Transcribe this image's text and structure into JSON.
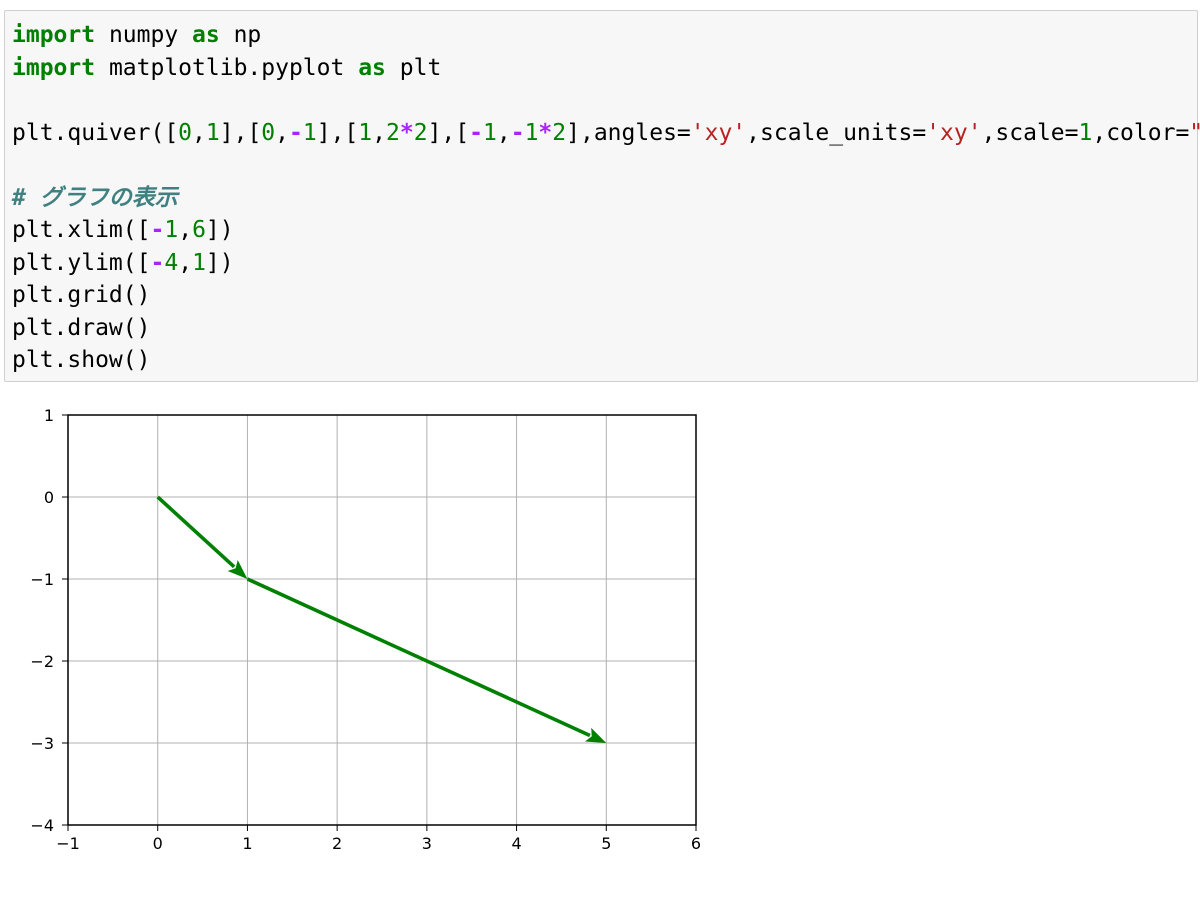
{
  "code_cell": {
    "lines": [
      [
        {
          "t": "import",
          "c": "kw"
        },
        {
          "t": " numpy "
        },
        {
          "t": "as",
          "c": "kw"
        },
        {
          "t": " np"
        }
      ],
      [
        {
          "t": "import",
          "c": "kw"
        },
        {
          "t": " matplotlib.pyplot "
        },
        {
          "t": "as",
          "c": "kw"
        },
        {
          "t": " plt"
        }
      ],
      [],
      [
        {
          "t": "plt.quiver(["
        },
        {
          "t": "0",
          "c": "num"
        },
        {
          "t": ","
        },
        {
          "t": "1",
          "c": "num"
        },
        {
          "t": "],["
        },
        {
          "t": "0",
          "c": "num"
        },
        {
          "t": ","
        },
        {
          "t": "-",
          "c": "op"
        },
        {
          "t": "1",
          "c": "num"
        },
        {
          "t": "],["
        },
        {
          "t": "1",
          "c": "num"
        },
        {
          "t": ","
        },
        {
          "t": "2",
          "c": "num"
        },
        {
          "t": "*",
          "c": "op"
        },
        {
          "t": "2",
          "c": "num"
        },
        {
          "t": "],["
        },
        {
          "t": "-",
          "c": "op"
        },
        {
          "t": "1",
          "c": "num"
        },
        {
          "t": ","
        },
        {
          "t": "-",
          "c": "op"
        },
        {
          "t": "1",
          "c": "num"
        },
        {
          "t": "*",
          "c": "op"
        },
        {
          "t": "2",
          "c": "num"
        },
        {
          "t": "],angles="
        },
        {
          "t": "'xy'",
          "c": "str"
        },
        {
          "t": ",scale_units="
        },
        {
          "t": "'xy'",
          "c": "str"
        },
        {
          "t": ",scale="
        },
        {
          "t": "1",
          "c": "num"
        },
        {
          "t": ",color="
        },
        {
          "t": "\"g\"",
          "c": "str"
        },
        {
          "t": ")"
        }
      ],
      [],
      [
        {
          "t": "# グラフの表示",
          "c": "cm"
        }
      ],
      [
        {
          "t": "plt.xlim(["
        },
        {
          "t": "-",
          "c": "op"
        },
        {
          "t": "1",
          "c": "num"
        },
        {
          "t": ","
        },
        {
          "t": "6",
          "c": "num"
        },
        {
          "t": "])"
        }
      ],
      [
        {
          "t": "plt.ylim(["
        },
        {
          "t": "-",
          "c": "op"
        },
        {
          "t": "4",
          "c": "num"
        },
        {
          "t": ","
        },
        {
          "t": "1",
          "c": "num"
        },
        {
          "t": "])"
        }
      ],
      [
        {
          "t": "plt.grid()"
        }
      ],
      [
        {
          "t": "plt.draw()"
        }
      ],
      [
        {
          "t": "plt.show()"
        }
      ]
    ]
  },
  "chart_data": {
    "type": "quiver",
    "title": "",
    "xlabel": "",
    "ylabel": "",
    "xlim": [
      -1,
      6
    ],
    "ylim": [
      -4,
      1
    ],
    "grid": true,
    "color": "#008000",
    "x_ticks": [
      "−1",
      "0",
      "1",
      "2",
      "3",
      "4",
      "5",
      "6"
    ],
    "y_ticks": [
      "1",
      "0",
      "−1",
      "−2",
      "−3",
      "−4"
    ],
    "arrows": [
      {
        "x": 0,
        "y": 0,
        "u": 1,
        "v": -1
      },
      {
        "x": 1,
        "y": -1,
        "u": 4,
        "v": -2
      }
    ]
  }
}
